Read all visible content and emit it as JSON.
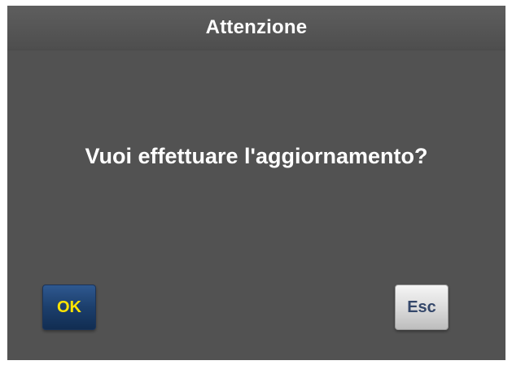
{
  "dialog": {
    "title": "Attenzione",
    "message": "Vuoi effettuare l'aggiornamento?",
    "ok_label": "OK",
    "esc_label": "Esc"
  },
  "colors": {
    "background": "#525252",
    "text": "#ffffff",
    "ok_button": "#1c3f6c",
    "ok_text": "#ffe400",
    "esc_button": "#dcdcdc",
    "esc_text": "#34476a"
  }
}
